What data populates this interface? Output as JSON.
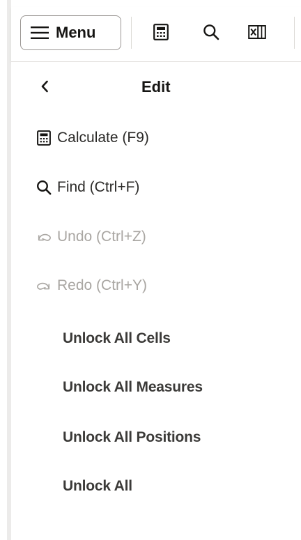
{
  "toolbar": {
    "menu_label": "Menu",
    "icons": [
      "calculator-icon",
      "search-icon",
      "excel-export-icon"
    ]
  },
  "panel": {
    "title": "Edit",
    "items": [
      {
        "label": "Calculate (F9)",
        "icon": "calculator-icon",
        "enabled": true
      },
      {
        "label": "Find (Ctrl+F)",
        "icon": "search-icon",
        "enabled": true
      },
      {
        "label": "Undo (Ctrl+Z)",
        "icon": "undo-icon",
        "enabled": false
      },
      {
        "label": "Redo (Ctrl+Y)",
        "icon": "redo-icon",
        "enabled": false
      },
      {
        "label": "Unlock All Cells",
        "enabled": true
      },
      {
        "label": "Unlock All Measures",
        "enabled": true
      },
      {
        "label": "Unlock All Positions",
        "enabled": true
      },
      {
        "label": "Unlock All",
        "enabled": true
      }
    ]
  },
  "colors": {
    "text": "#161513",
    "disabled_text": "#a9a6a2",
    "border": "#9a9693",
    "rule": "#ecebea"
  }
}
